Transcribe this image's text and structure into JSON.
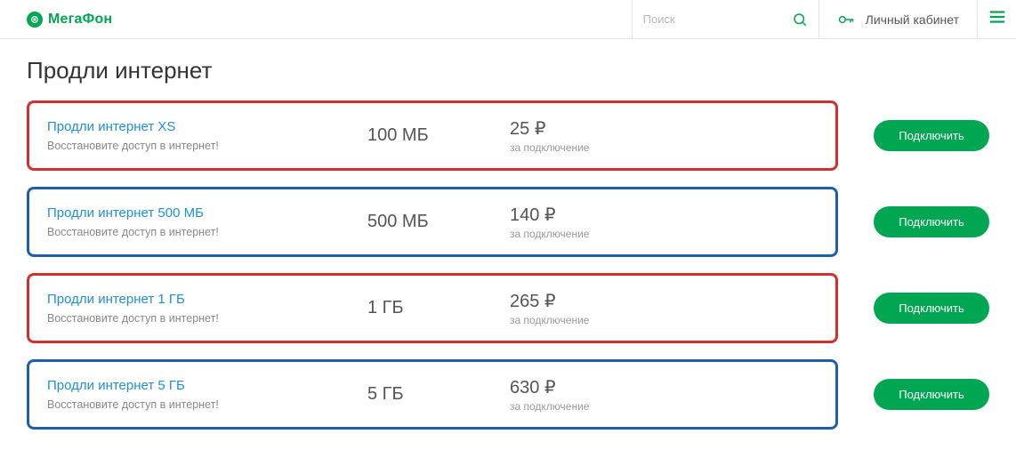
{
  "header": {
    "brand": "МегаФон",
    "search_placeholder": "Поиск",
    "cabinet_label": "Личный кабинет"
  },
  "page": {
    "title": "Продли интернет"
  },
  "plans": [
    {
      "title": "Продли интернет XS",
      "subtitle": "Восстановите доступ в интернет!",
      "quota": "100 МБ",
      "price": "25 ₽",
      "price_sub": "за подключение",
      "button": "Подключить",
      "highlight": "red"
    },
    {
      "title": "Продли интернет 500 МБ",
      "subtitle": "Восстановите доступ в интернет!",
      "quota": "500 МБ",
      "price": "140 ₽",
      "price_sub": "за подключение",
      "button": "Подключить",
      "highlight": "blue"
    },
    {
      "title": "Продли интернет 1 ГБ",
      "subtitle": "Восстановите доступ в интернет!",
      "quota": "1 ГБ",
      "price": "265 ₽",
      "price_sub": "за подключение",
      "button": "Подключить",
      "highlight": "red"
    },
    {
      "title": "Продли интернет 5 ГБ",
      "subtitle": "Восстановите доступ в интернет!",
      "quota": "5 ГБ",
      "price": "630 ₽",
      "price_sub": "за подключение",
      "button": "Подключить",
      "highlight": "blue"
    }
  ],
  "colors": {
    "accent": "#00a651",
    "link": "#1f8fd6",
    "highlight_red": "#d22f2f",
    "highlight_blue": "#1f5ea8"
  }
}
